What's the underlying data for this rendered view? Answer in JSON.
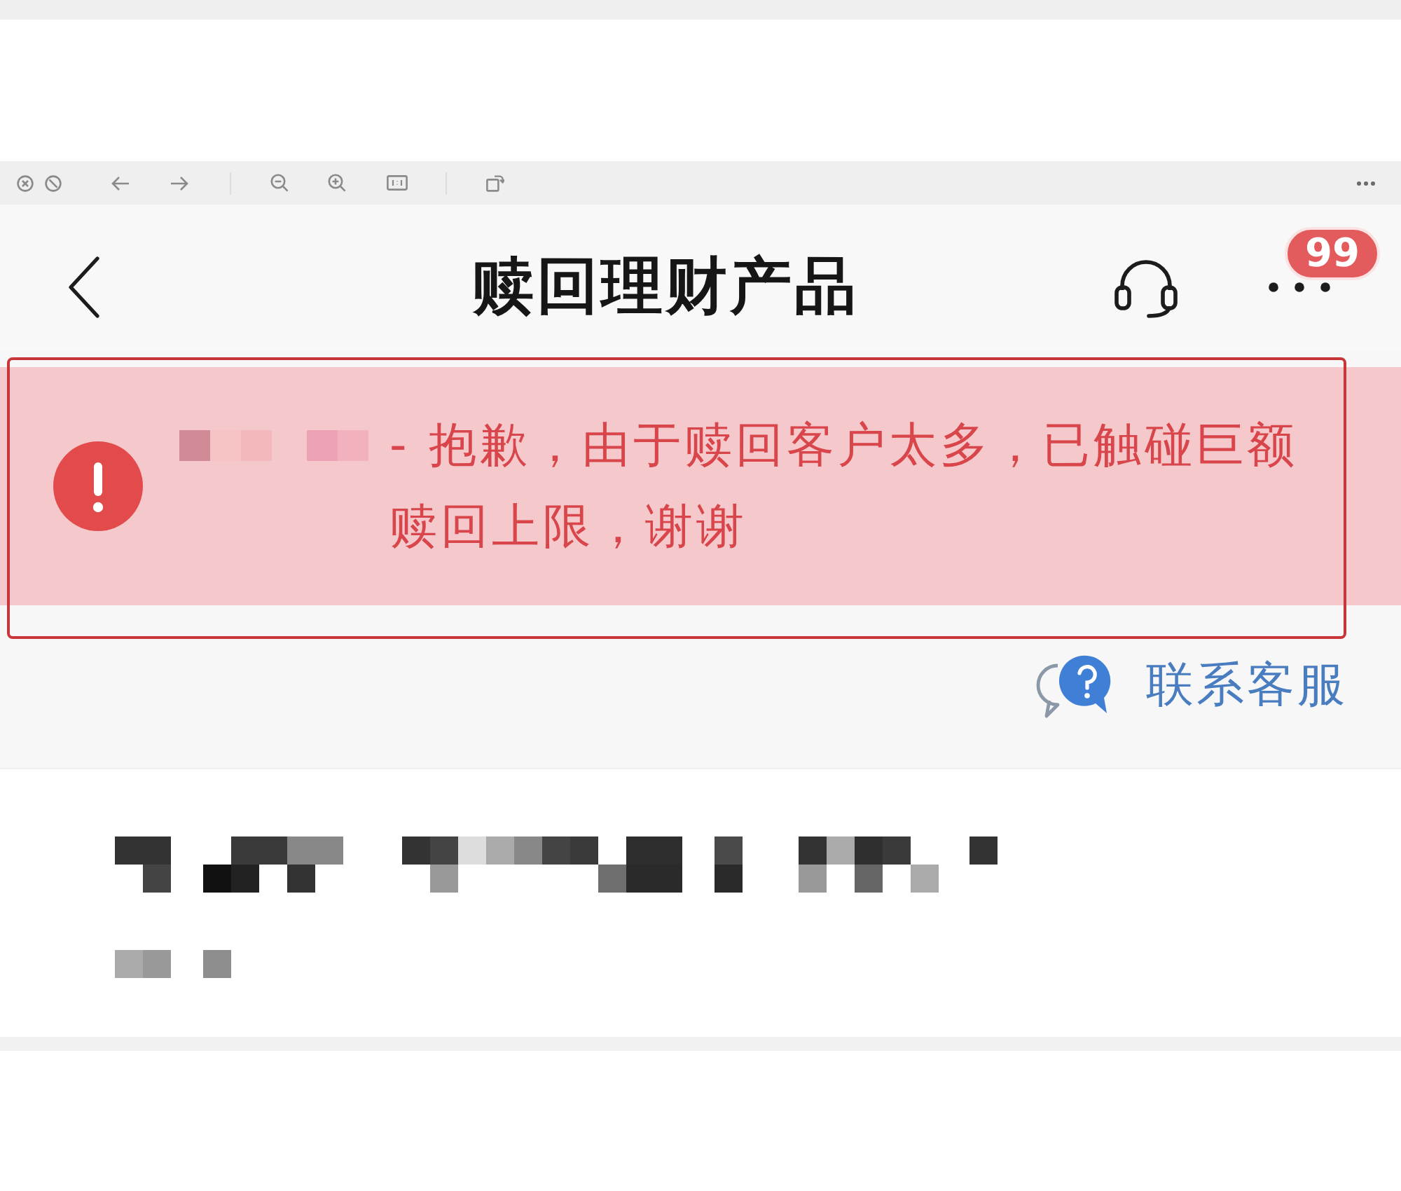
{
  "header": {
    "title": "赎回理财产品",
    "badge": "99"
  },
  "alert": {
    "message": "- 抱歉，由于赎回客户太多，已触碰巨额赎回上限，谢谢"
  },
  "contact_link": {
    "label": "联系客服"
  }
}
